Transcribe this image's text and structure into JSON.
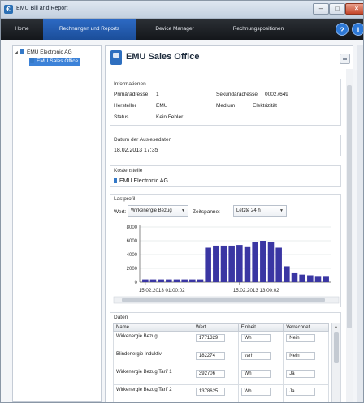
{
  "window": {
    "title": "EMU Bill and Report"
  },
  "menu": {
    "home": "Home",
    "billing": "Rechnungen und Reports",
    "device": "Device Manager",
    "positions": "Rechnungspositionen",
    "help_glyph": "?",
    "info_glyph": "i"
  },
  "tree": {
    "root": "EMU Electronic AG",
    "child": "EMU Sales Office"
  },
  "page": {
    "title": "EMU Sales Office"
  },
  "info": {
    "title": "Informationen",
    "primary_label": "Primäradresse",
    "primary_value": "1",
    "secondary_label": "Sekundäradresse",
    "secondary_value": "00027649",
    "maker_label": "Hersteller",
    "maker_value": "EMU",
    "medium_label": "Medium",
    "medium_value": "Elektrizität",
    "status_label": "Status",
    "status_value": "Kein Fehler"
  },
  "readout": {
    "title": "Datum der Auslesedaten",
    "value": "18.02.2013 17:35"
  },
  "cost_center": {
    "title": "Kostenstelle",
    "value": "EMU Electronic AG"
  },
  "profile": {
    "title": "Lastprofil",
    "value_label": "Wert:",
    "value_selected": "Wirkenergie Bezug",
    "period_label": "Zeitspanne:",
    "period_selected": "Letzte 24 h"
  },
  "chart_data": {
    "type": "bar",
    "y_ticks": [
      "8000",
      "6000",
      "4000",
      "2000",
      "0"
    ],
    "ylim": [
      0,
      8000
    ],
    "x_labels": [
      "15.02.2013 01:00:02",
      "15.02.2013 13:00:02"
    ],
    "values": [
      400,
      400,
      400,
      400,
      400,
      400,
      400,
      400,
      5000,
      5300,
      5300,
      5300,
      5400,
      5200,
      5800,
      6000,
      5800,
      5000,
      2300,
      1300,
      1100,
      1000,
      900,
      900
    ],
    "bar_color": "#3a36a3",
    "grid": true
  },
  "data_table": {
    "title": "Daten",
    "columns": [
      "Name",
      "Wert",
      "Einheit",
      "Verrechnet"
    ],
    "rows": [
      [
        "Wirkenergie Bezug",
        "1771329",
        "Wh",
        "Nein"
      ],
      [
        "Blindenergie Induktiv",
        "182274",
        "varh",
        "Nein"
      ],
      [
        "Wirkenergie Bezug Tarif 1",
        "392706",
        "Wh",
        "Ja"
      ],
      [
        "Wirkenergie Bezug Tarif 2",
        "1378625",
        "Wh",
        "Ja"
      ]
    ]
  }
}
